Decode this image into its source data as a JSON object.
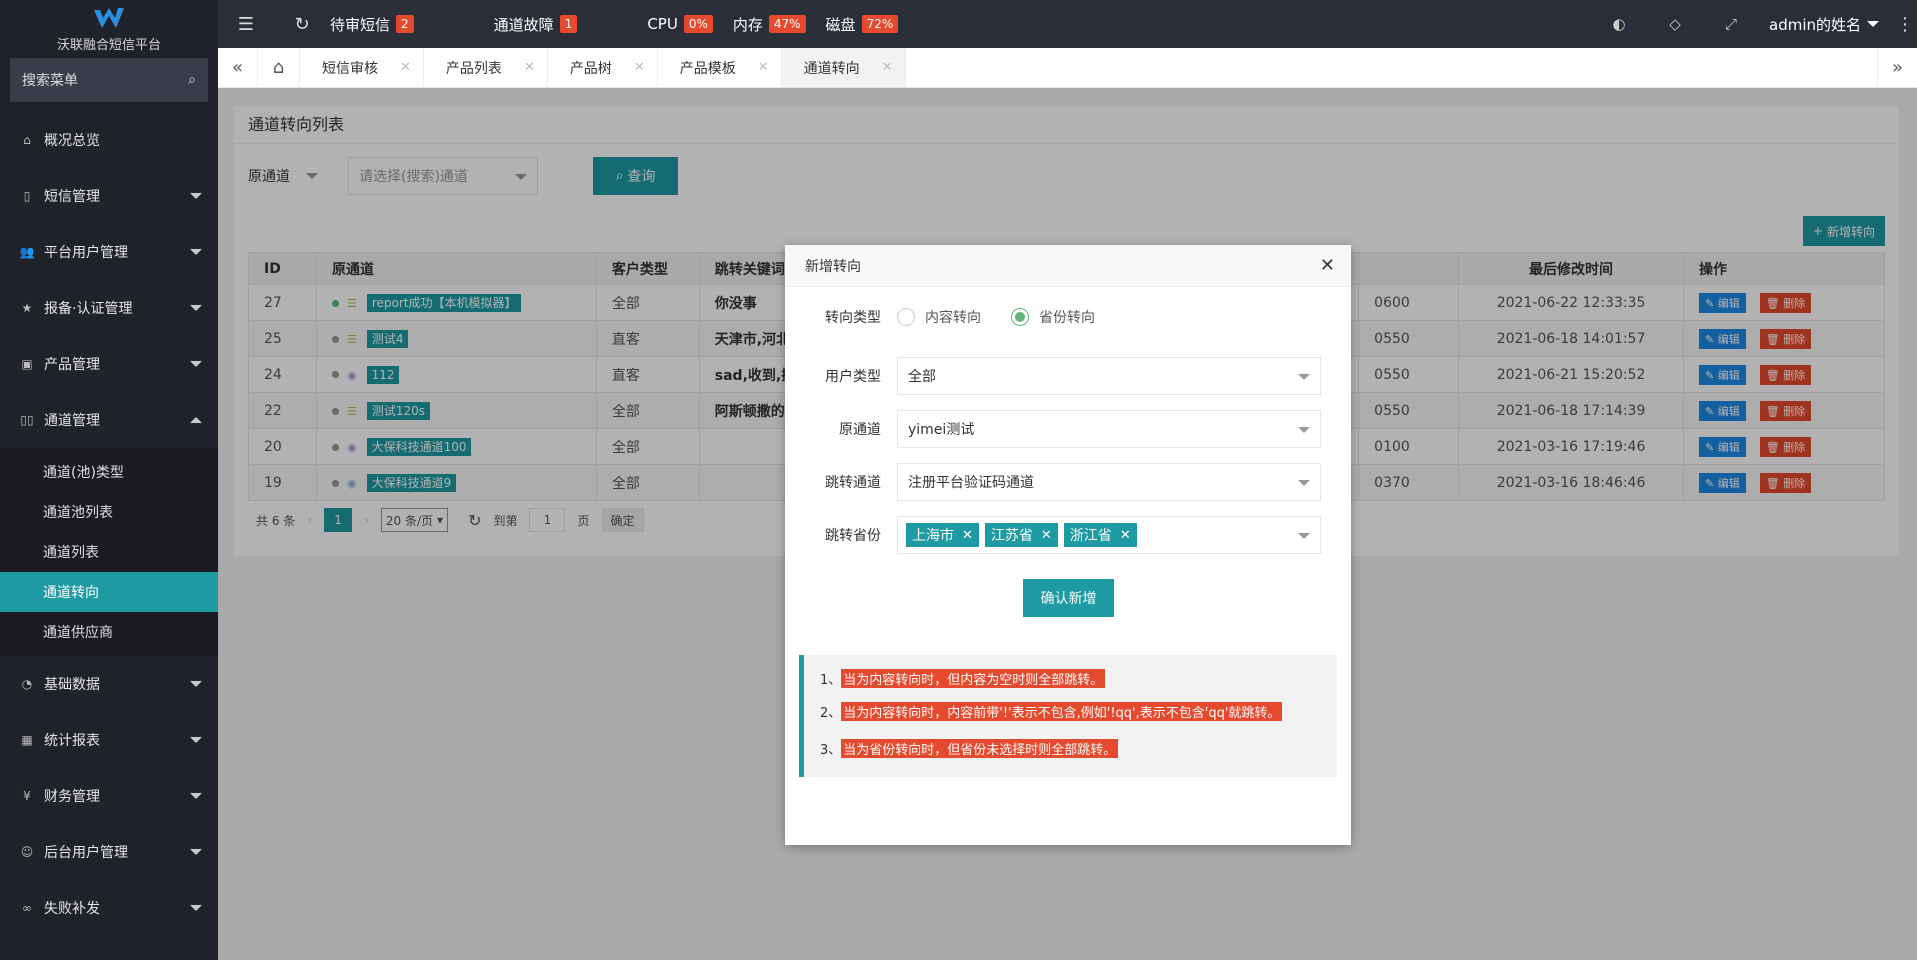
{
  "sidebar": {
    "logo_text": "沃联融合短信平台",
    "search_placeholder": "搜索菜单",
    "items": [
      {
        "label": "概况总览"
      },
      {
        "label": "短信管理"
      },
      {
        "label": "平台用户管理"
      },
      {
        "label": "报备·认证管理"
      },
      {
        "label": "产品管理"
      },
      {
        "label": "通道管理"
      },
      {
        "label": "基础数据"
      },
      {
        "label": "统计报表"
      },
      {
        "label": "财务管理"
      },
      {
        "label": "后台用户管理"
      },
      {
        "label": "失败补发"
      }
    ],
    "submenu": [
      {
        "label": "通道(池)类型"
      },
      {
        "label": "通道池列表"
      },
      {
        "label": "通道列表"
      },
      {
        "label": "通道转向"
      },
      {
        "label": "通道供应商"
      }
    ]
  },
  "header": {
    "pending_sms": "待审短信",
    "pending_sms_count": "2",
    "channel_fault": "通道故障",
    "channel_fault_count": "1",
    "cpu": "CPU",
    "cpu_val": "0%",
    "mem": "内存",
    "mem_val": "47%",
    "disk": "磁盘",
    "disk_val": "72%",
    "user": "admin的姓名"
  },
  "tabs": [
    {
      "label": "短信审核"
    },
    {
      "label": "产品列表"
    },
    {
      "label": "产品树"
    },
    {
      "label": "产品模板"
    },
    {
      "label": "通道转向"
    }
  ],
  "page": {
    "title": "通道转向列表",
    "filter_label": "原通道",
    "filter_placeholder": "请选择(搜索)通道",
    "query_btn": "查询",
    "add_btn": "新增转向"
  },
  "table": {
    "headers": [
      "ID",
      "原通道",
      "客户类型",
      "跳转关键词",
      "",
      "最后修改时间",
      "操作"
    ],
    "rows": [
      {
        "id": "27",
        "channel": "report成功【本机模拟器】",
        "type": "全部",
        "kw": "你没事",
        "code": "0600",
        "time": "2021-06-22 12:33:35"
      },
      {
        "id": "25",
        "channel": "测试4",
        "type": "直客",
        "kw": "天津市,河北",
        "code": "0550",
        "time": "2021-06-18 14:01:57"
      },
      {
        "id": "24",
        "channel": "112",
        "type": "直客",
        "kw": "sad,收到,揽",
        "code": "0550",
        "time": "2021-06-21 15:20:52"
      },
      {
        "id": "22",
        "channel": "测试120s",
        "type": "全部",
        "kw": "阿斯顿撒的",
        "code": "0550",
        "time": "2021-06-18 17:14:39"
      },
      {
        "id": "20",
        "channel": "大保科技通道100",
        "type": "全部",
        "kw": "",
        "code": "0100",
        "time": "2021-03-16 17:19:46"
      },
      {
        "id": "19",
        "channel": "大保科技通道9",
        "type": "全部",
        "kw": "",
        "code": "0370",
        "time": "2021-03-16 18:46:46"
      }
    ],
    "edit": "编辑",
    "delete": "删除"
  },
  "pager": {
    "total": "共 6 条",
    "current": "1",
    "size": "20 条/页",
    "goto": "到第",
    "page_input": "1",
    "page_unit": "页",
    "ok": "确定"
  },
  "modal": {
    "title": "新增转向",
    "type_label": "转向类型",
    "opt_content": "内容转向",
    "opt_province": "省份转向",
    "user_type_label": "用户类型",
    "user_type_val": "全部",
    "orig_label": "原通道",
    "orig_val": "yimei测试",
    "jump_label": "跳转通道",
    "jump_val": "注册平台验证码通道",
    "prov_label": "跳转省份",
    "provinces": [
      "上海市",
      "江苏省",
      "浙江省"
    ],
    "confirm": "确认新增",
    "notes": [
      {
        "n": "1、",
        "t": "当为内容转向时，但内容为空时则全部跳转。"
      },
      {
        "n": "2、",
        "t": "当为内容转向时，内容前带'!'表示不包含,例如'!qq',表示不包含'qq'就跳转。"
      },
      {
        "n": "3、",
        "t": "当为省份转向时，但省份未选择时则全部跳转。"
      }
    ]
  }
}
